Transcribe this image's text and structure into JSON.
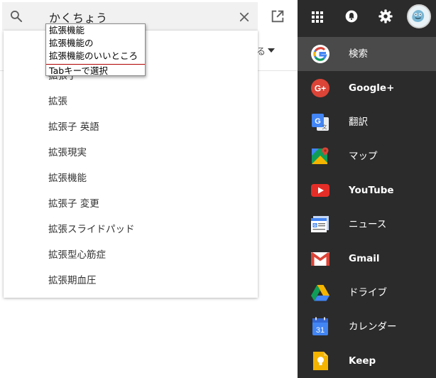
{
  "search": {
    "query": "かくちょう",
    "icons": {
      "search": "search-icon",
      "clear": "close-icon",
      "open_external": "open-in-new-icon"
    }
  },
  "results_strip": {
    "more_label": "る"
  },
  "ime": {
    "candidates": [
      "拡張機能",
      "拡張機能の",
      "拡張機能のいいところ"
    ],
    "hint": "Tabキーで選択"
  },
  "suggestions": [
    "拡張子",
    "拡張",
    "拡張子 英語",
    "拡張現実",
    "拡張機能",
    "拡張子 変更",
    "拡張スライドパッド",
    "拡張型心筋症",
    "拡張期血圧"
  ],
  "top_icons": {
    "apps": "apps-grid-icon",
    "notifications": "bell-icon",
    "settings": "gear-icon",
    "account": "avatar"
  },
  "apps": [
    {
      "label": "検索",
      "icon": "google-search-icon",
      "active": true
    },
    {
      "label": "Google+",
      "icon": "google-plus-icon"
    },
    {
      "label": "翻訳",
      "icon": "google-translate-icon"
    },
    {
      "label": "マップ",
      "icon": "google-maps-icon"
    },
    {
      "label": "YouTube",
      "icon": "youtube-icon"
    },
    {
      "label": "ニュース",
      "icon": "google-news-icon"
    },
    {
      "label": "Gmail",
      "icon": "gmail-icon"
    },
    {
      "label": "ドライブ",
      "icon": "google-drive-icon"
    },
    {
      "label": "カレンダー",
      "icon": "google-calendar-icon"
    },
    {
      "label": "Keep",
      "icon": "google-keep-icon"
    }
  ],
  "calendar_icon_day": "31",
  "colors": {
    "panel_bg": "#2b2b2b",
    "active_row": "#4a4a4a",
    "search_bg": "#f1f1f1",
    "google_blue": "#4285f4",
    "google_red": "#db4437",
    "youtube_red": "#e52d27",
    "google_yellow": "#f4b400",
    "google_green": "#0f9d58"
  }
}
